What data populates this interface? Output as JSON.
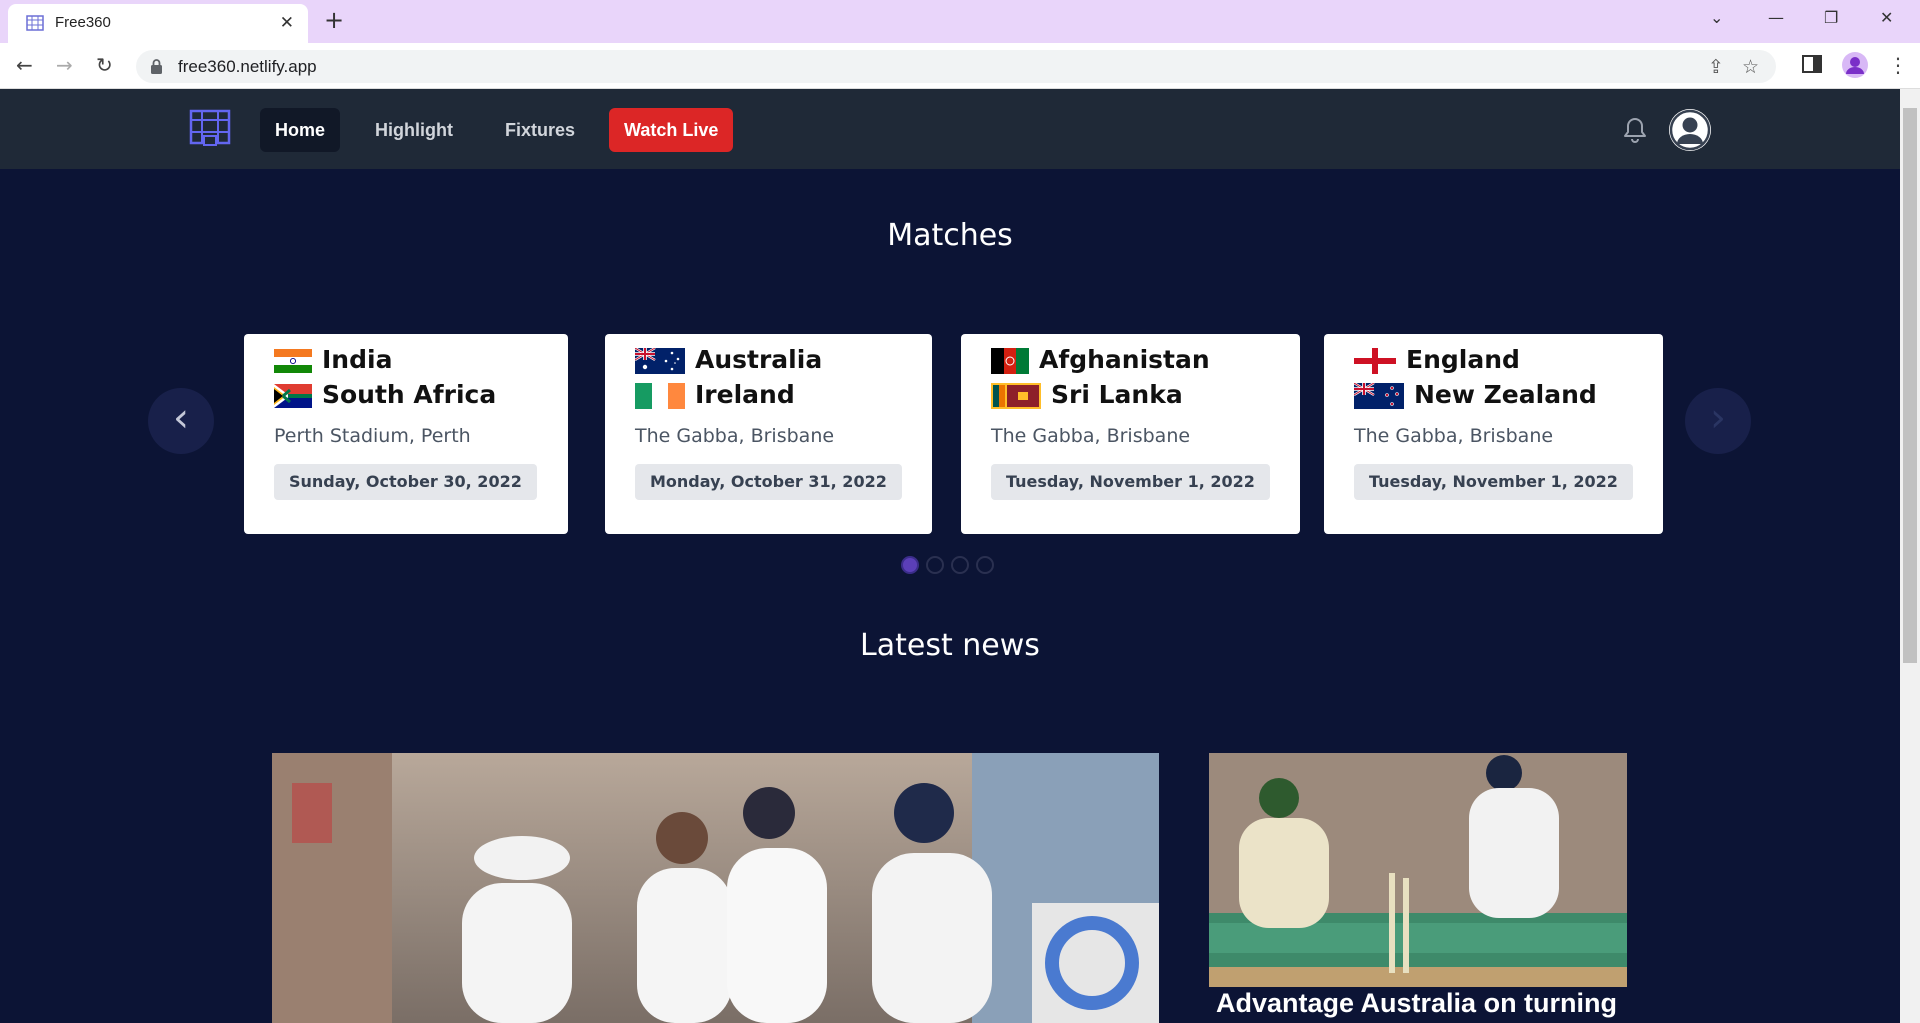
{
  "browser": {
    "tab_title": "Free360",
    "url": "free360.netlify.app"
  },
  "nav": {
    "home": "Home",
    "highlight": "Highlight",
    "fixtures": "Fixtures",
    "watch_live": "Watch Live"
  },
  "matches": {
    "title": "Matches",
    "cards": [
      {
        "team1": "India",
        "team2": "South Africa",
        "venue": "Perth Stadium, Perth",
        "date": "Sunday, October 30, 2022"
      },
      {
        "team1": "Australia",
        "team2": "Ireland",
        "venue": "The Gabba, Brisbane",
        "date": "Monday, October 31, 2022"
      },
      {
        "team1": "Afghanistan",
        "team2": "Sri Lanka",
        "venue": "The Gabba, Brisbane",
        "date": "Tuesday, November 1, 2022"
      },
      {
        "team1": "England",
        "team2": "New Zealand",
        "venue": "The Gabba, Brisbane",
        "date": "Tuesday, November 1, 2022"
      }
    ],
    "carousel_prev": "‹",
    "carousel_next": "›",
    "page_count": 4,
    "active_page": 1
  },
  "news": {
    "title": "Latest news",
    "side_caption": "Advantage Australia on turning"
  },
  "colors": {
    "page_bg": "#0c1435",
    "navbar_bg": "#1f2937",
    "live_red": "#dc2626",
    "tabbar_bg": "#e9d5fa"
  }
}
